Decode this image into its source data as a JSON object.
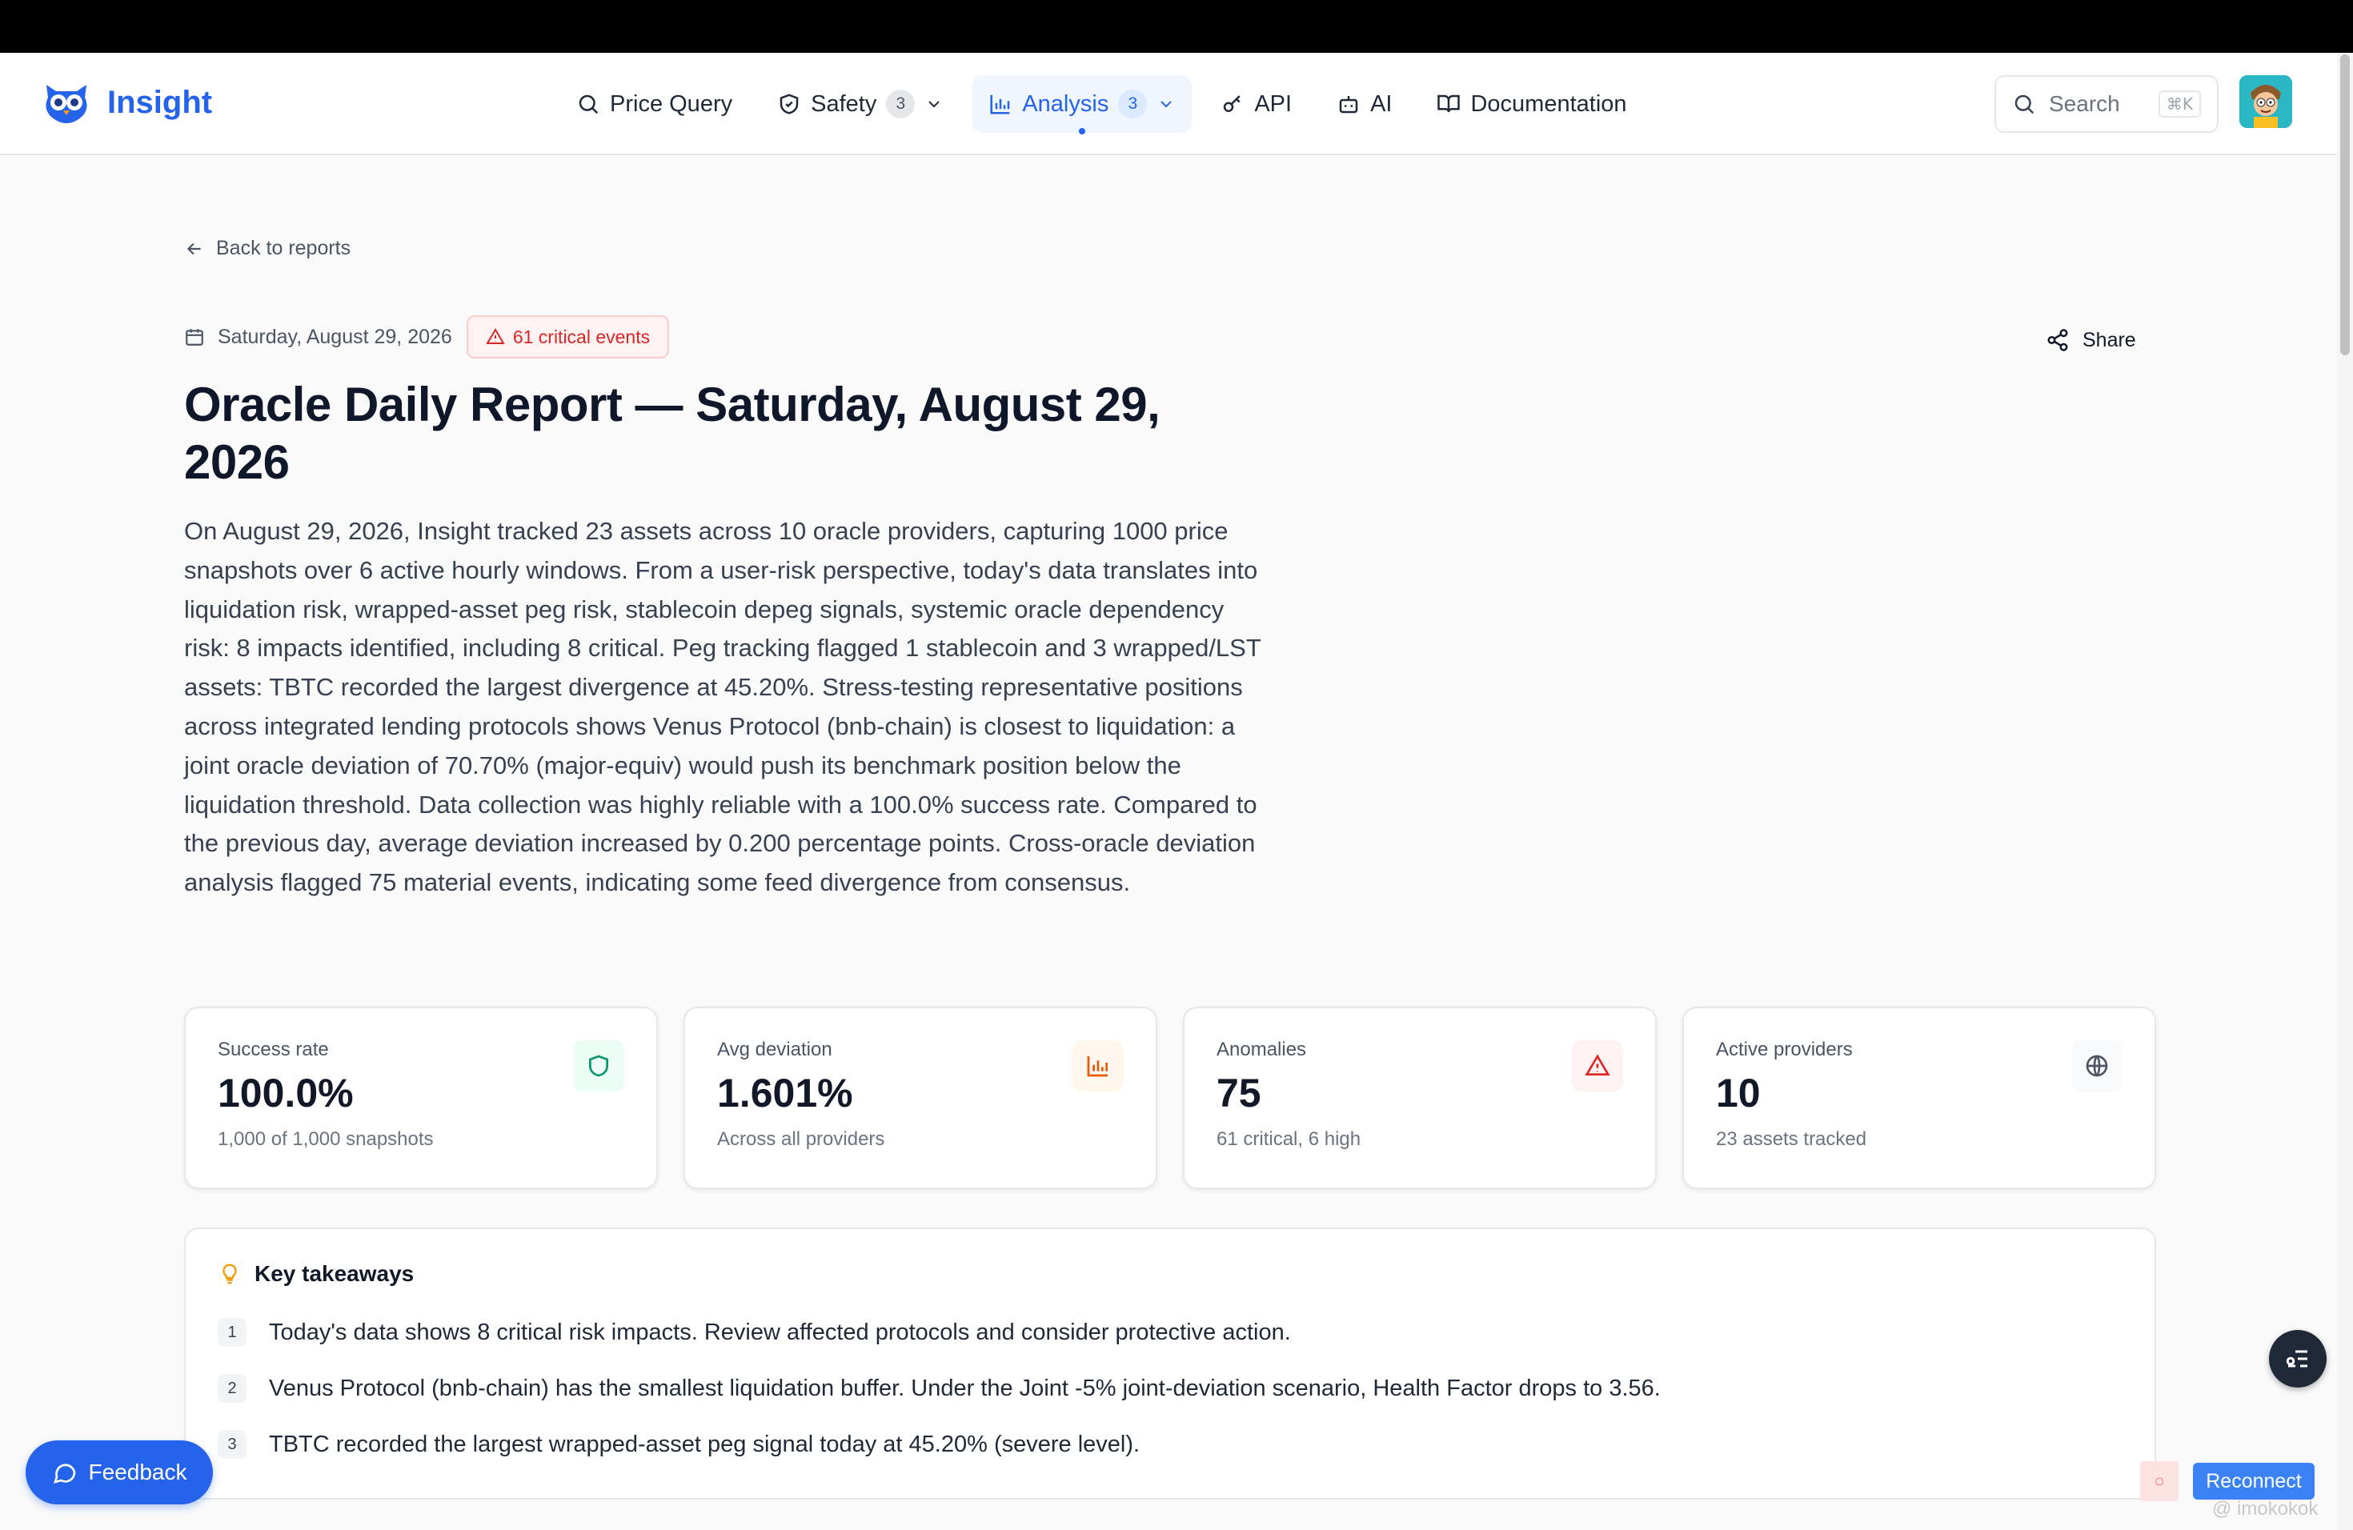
{
  "app": {
    "name": "Insight"
  },
  "nav": {
    "items": [
      {
        "label": "Price Query",
        "icon": "search-icon"
      },
      {
        "label": "Safety",
        "badge": "3",
        "icon": "shield-icon"
      },
      {
        "label": "Analysis",
        "badge": "3",
        "icon": "bar-chart-icon",
        "active": true
      },
      {
        "label": "API",
        "icon": "key-icon"
      },
      {
        "label": "AI",
        "icon": "bot-icon"
      },
      {
        "label": "Documentation",
        "icon": "book-icon"
      }
    ]
  },
  "search": {
    "label": "Search",
    "shortcut": "⌘K"
  },
  "back": {
    "label": "Back to reports"
  },
  "report": {
    "date": "Saturday, August 29, 2026",
    "critical_badge": "61 critical events",
    "share_label": "Share",
    "title": "Oracle Daily Report — Saturday, August 29, 2026",
    "summary": "On August 29, 2026, Insight tracked 23 assets across 10 oracle providers, capturing 1000 price snapshots over 6 active hourly windows. From a user-risk perspective, today's data translates into liquidation risk, wrapped-asset peg risk, stablecoin depeg signals, systemic oracle dependency risk: 8 impacts identified, including 8 critical. Peg tracking flagged 1 stablecoin and 3 wrapped/LST assets: TBTC recorded the largest divergence at 45.20%. Stress-testing representative positions across integrated lending protocols shows Venus Protocol (bnb-chain) is closest to liquidation: a joint oracle deviation of 70.70% (major-equiv) would push its benchmark position below the liquidation threshold. Data collection was highly reliable with a 100.0% success rate. Compared to the previous day, average deviation increased by 0.200 percentage points. Cross-oracle deviation analysis flagged 75 material events, indicating some feed divergence from consensus."
  },
  "stats": [
    {
      "label": "Success rate",
      "value": "100.0%",
      "sub": "1,000 of 1,000 snapshots",
      "icon": "shield-icon",
      "color": "#059669",
      "bg": "#ecfdf5"
    },
    {
      "label": "Avg deviation",
      "value": "1.601%",
      "sub": "Across all providers",
      "icon": "bar-chart-icon",
      "color": "#ea580c",
      "bg": "#fff7ed"
    },
    {
      "label": "Anomalies",
      "value": "75",
      "sub": "61 critical, 6 high",
      "icon": "alert-triangle-icon",
      "color": "#dc2626",
      "bg": "#fef2f2"
    },
    {
      "label": "Active providers",
      "value": "10",
      "sub": "23 assets tracked",
      "icon": "globe-icon",
      "color": "#4b5563",
      "bg": "#f9fafb"
    }
  ],
  "takeaways": {
    "title": "Key takeaways",
    "items": [
      {
        "num": "1",
        "text": "Today's data shows 8 critical risk impacts. Review affected protocols and consider protective action."
      },
      {
        "num": "2",
        "text": "Venus Protocol (bnb-chain) has the smallest liquidation buffer. Under the Joint -5% joint-deviation scenario, Health Factor drops to 3.56."
      },
      {
        "num": "3",
        "text": "TBTC recorded the largest wrapped-asset peg signal today at 45.20% (severe level)."
      }
    ]
  },
  "feedback": {
    "label": "Feedback"
  },
  "connection": {
    "status_glyph": "○",
    "reconnect_label": "Reconnect"
  },
  "watermark": {
    "text": "@ imokokok"
  },
  "colors": {
    "brand": "#2563eb",
    "critical": "#dc2626"
  }
}
